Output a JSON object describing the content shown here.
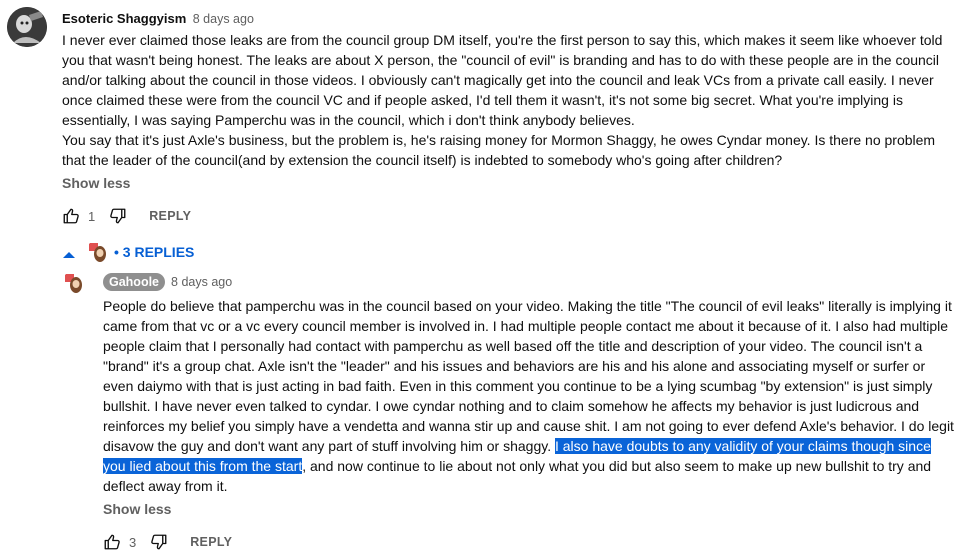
{
  "comment": {
    "author": "Esoteric Shaggyism",
    "time": "8 days ago",
    "paragraph1": "I never ever claimed those leaks are from the council group DM itself, you're the first person to say this, which makes it seem like whoever told you that wasn't being honest. The leaks are about X person, the \"council of evil\" is branding and has to do with these people are in the council and/or talking about the council in those videos. I obviously can't magically get into the council and leak VCs from a private call easily. I never once claimed these were from the council VC and if people asked, I'd tell them it wasn't, it's not some big secret. What you're implying is essentially, I was saying Pamperchu was in the council, which i don't think anybody believes.",
    "paragraph2": "You say that it's just Axle's business, but the problem is, he's raising money for Mormon Shaggy, he owes Cyndar money. Is there no problem that the leader of the council(and by extension the council itself) is indebted to somebody who's going after children?",
    "show_less": "Show less",
    "like_count": "1",
    "reply_label": "REPLY",
    "icons": {
      "like": "thumb-up-icon",
      "dislike": "thumb-down-icon"
    }
  },
  "replies_toggle": {
    "label": "• 3 REPLIES",
    "icon": "caret-up-icon"
  },
  "reply": {
    "author": "Gahoole",
    "time": "8 days ago",
    "text_before": "People do believe that pamperchu was in the council based on your video. Making the title \"The council of evil leaks\" literally is implying it came from that vc or a vc every council member is involved in. I had multiple people contact me about it because of it. I also had multiple people claim that I personally had contact with pamperchu as well based off the title and description of your video. The council isn't a \"brand\" it's a group chat. Axle isn't the \"leader\" and his issues and behaviors are his and his alone and associating myself or surfer or even daiymo with that is just acting in bad faith. Even in this comment you continue to be a lying scumbag \"by extension\" is just simply bullshit. I have never even talked to cyndar. I owe cyndar nothing and to claim somehow he affects my behavior is just ludicrous and reinforces my belief you simply have a vendetta and wanna stir up and cause shit. I am not going to ever defend Axle's behavior. I do legit disavow the guy and don't want any part of stuff involving him or shaggy. ",
    "text_highlight": "I also have doubts to any validity of your claims though since you lied about this from the start",
    "text_after": ", and now continue to lie about not only what you did but also seem to make up new bullshit to try and deflect away from it.",
    "show_less": "Show less",
    "like_count": "3",
    "reply_label": "REPLY"
  },
  "colors": {
    "link_blue": "#065fd4",
    "highlight": "#0a64d8",
    "secondary_text": "#606060",
    "badge_grey": "#8f8f8f"
  }
}
